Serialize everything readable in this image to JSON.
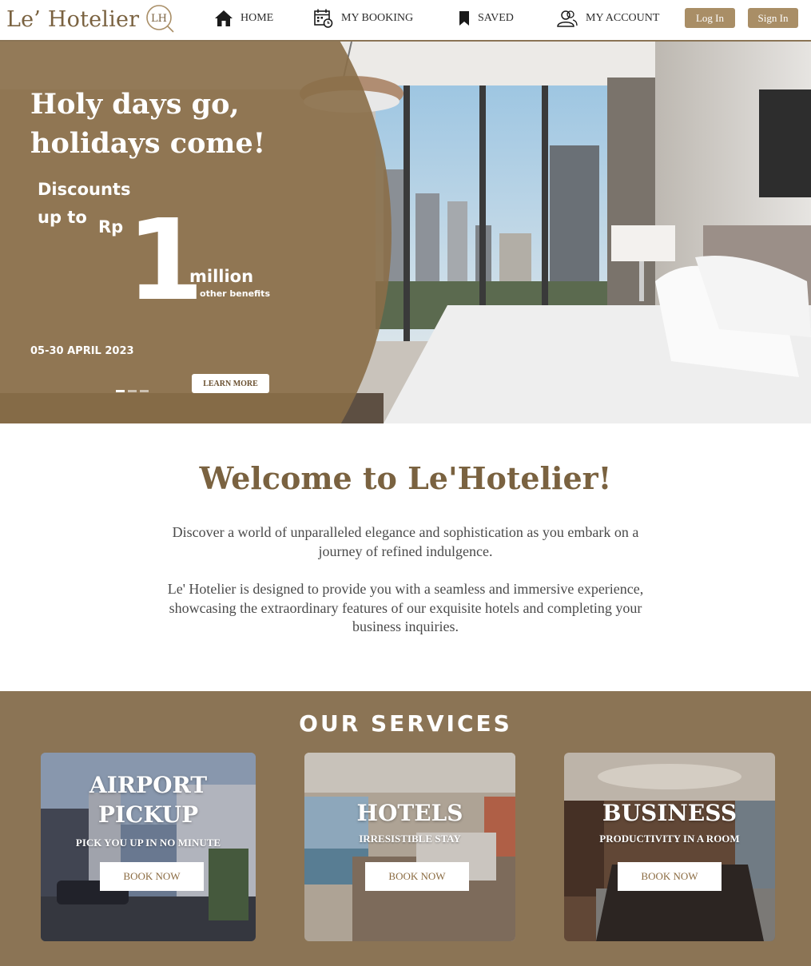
{
  "header": {
    "logo_text": "Le’ Hotelier",
    "logo_mark": "LH",
    "nav": [
      {
        "label": "HOME",
        "icon": "home-icon"
      },
      {
        "label": "MY BOOKING",
        "icon": "calendar-icon"
      },
      {
        "label": "SAVED",
        "icon": "bookmark-icon"
      },
      {
        "label": "MY ACCOUNT",
        "icon": "account-icon"
      }
    ],
    "login_label": "Log In",
    "signin_label": "Sign In"
  },
  "hero": {
    "title_line1": "Holy days go,",
    "title_line2": "holidays come!",
    "discount_line1": "Discounts",
    "discount_line2": "up to",
    "currency": "Rp",
    "amount": "1",
    "unit": "million",
    "benefits": "+ other benefits",
    "date": "05-30 APRIL 2023",
    "learn_more": "LEARN MORE",
    "slides": 3,
    "active_slide": 1
  },
  "welcome": {
    "title": "Welcome to Le'Hotelier!",
    "paragraph1": "Discover a world of unparalleled elegance and sophistication as you embark on a journey of refined indulgence.",
    "paragraph2": "Le' Hotelier is designed to provide you with a seamless and immersive experience, showcasing the extraordinary features of our exquisite hotels and completing your business inquiries."
  },
  "services": {
    "title": "OUR SERVICES",
    "cards": [
      {
        "title_line1": "AIRPORT",
        "title_line2": "PICKUP",
        "subtitle": "PICK YOU UP IN NO MINUTE",
        "button": "BOOK NOW"
      },
      {
        "title_line1": "HOTELS",
        "subtitle": "IRRESISTIBLE STAY",
        "button": "BOOK NOW"
      },
      {
        "title_line1": "BUSINESS",
        "subtitle": "PRODUCTIVITY IN A ROOM",
        "button": "BOOK NOW"
      }
    ]
  },
  "colors": {
    "brand": "#7a6240",
    "accent": "#a98e66",
    "services_bg": "#8b7455"
  }
}
